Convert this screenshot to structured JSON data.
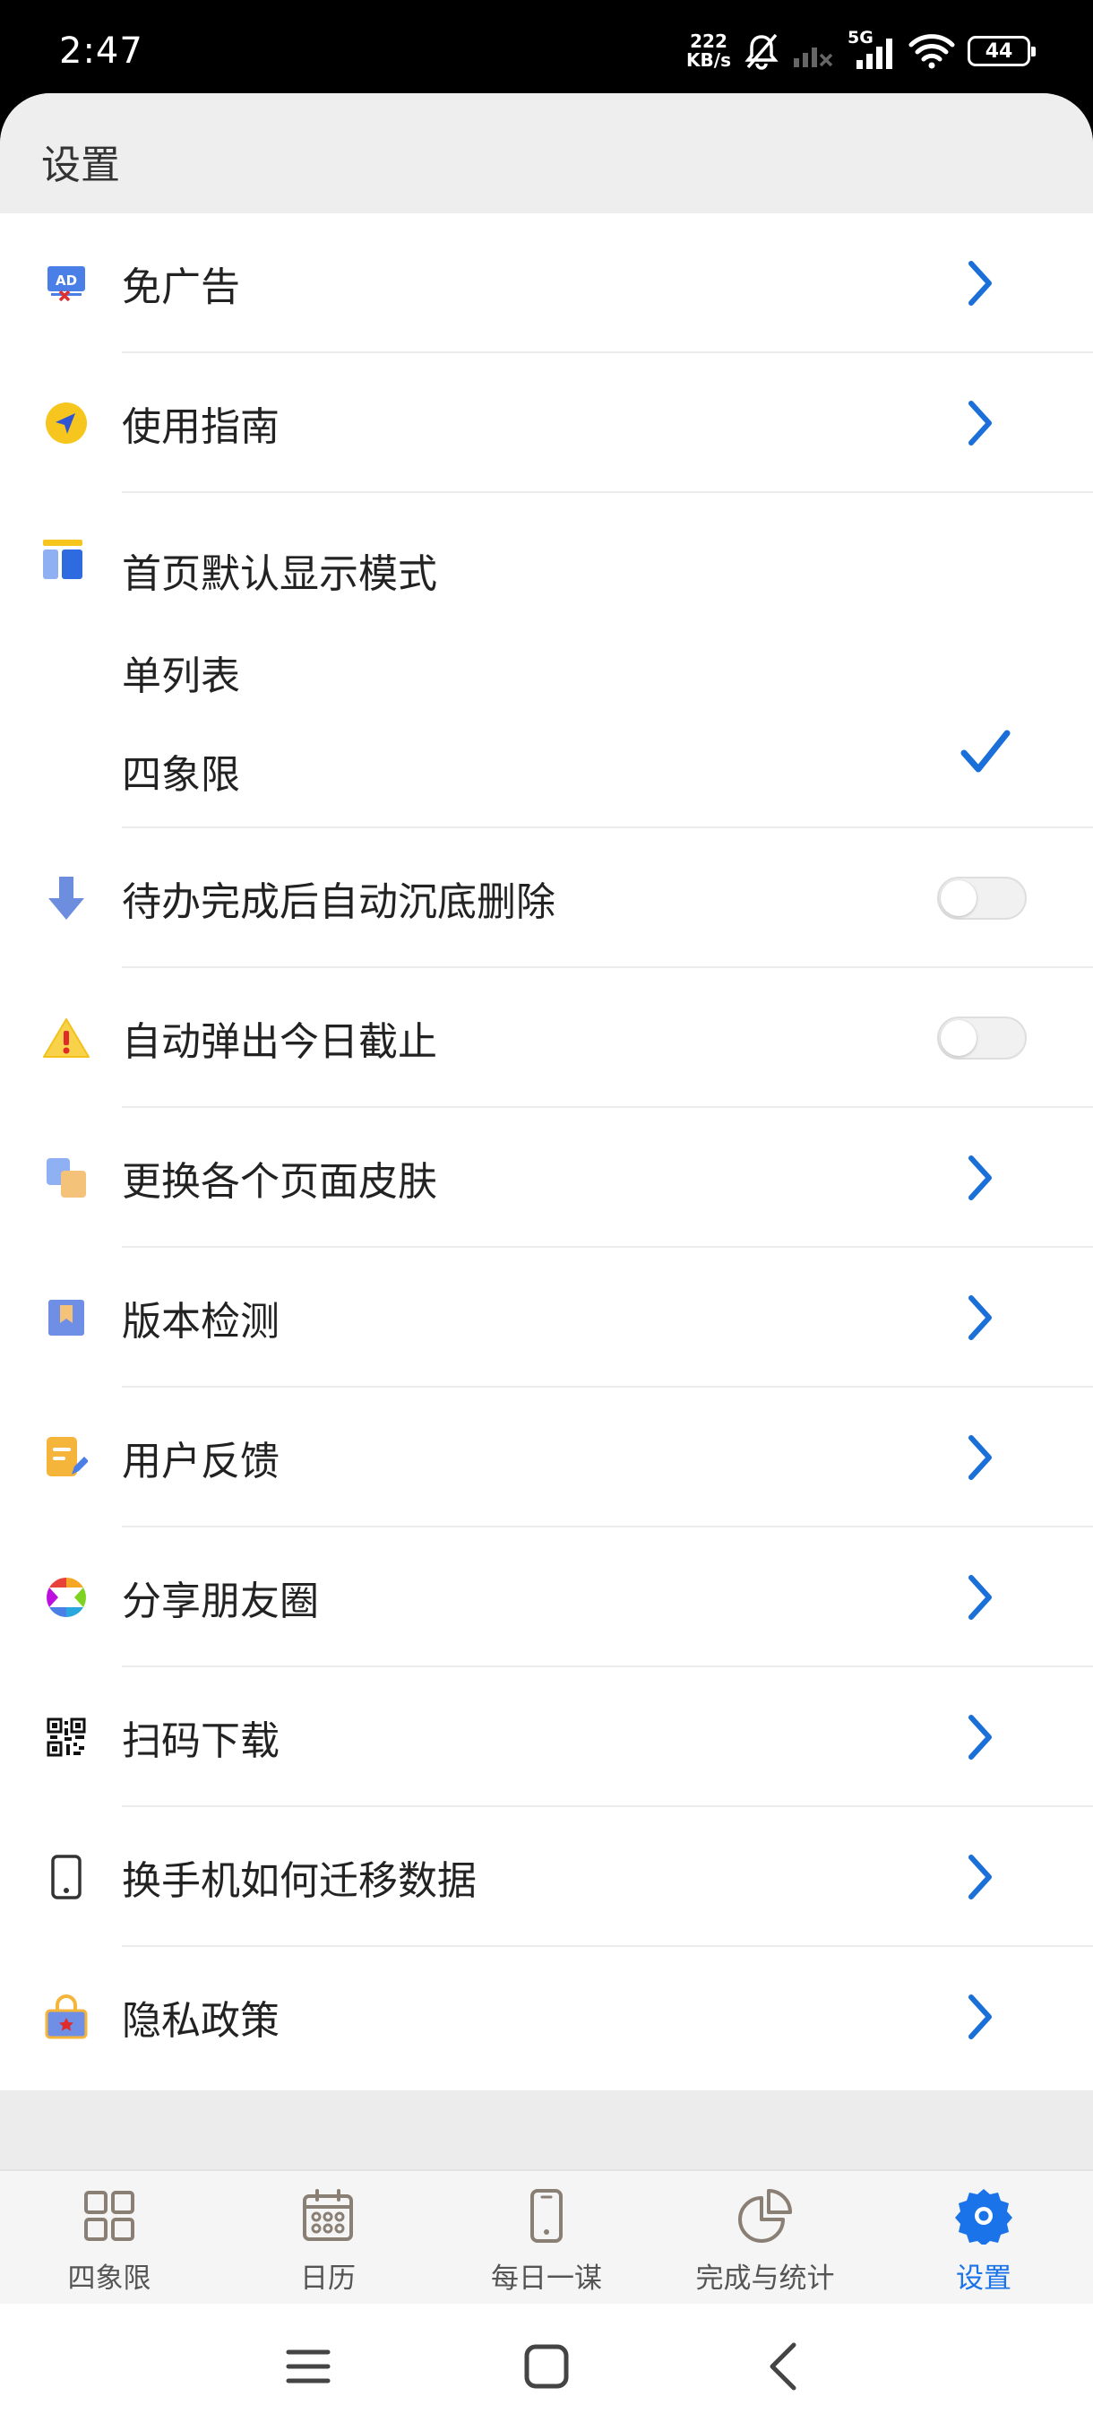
{
  "status_bar": {
    "time": "2:47",
    "net_speed_value": "222",
    "net_speed_unit": "KB/s",
    "network_type": "5G",
    "battery": "44"
  },
  "header": {
    "title": "设置"
  },
  "settings": {
    "remove_ads": "免广告",
    "guide": "使用指南",
    "home_mode_title": "首页默认显示模式",
    "mode_single_list": "单列表",
    "mode_quadrant": "四象限",
    "selected_mode": "四象限",
    "auto_sink_delete": "待办完成后自动沉底删除",
    "auto_sink_delete_on": false,
    "auto_popup_today": "自动弹出今日截止",
    "auto_popup_today_on": false,
    "change_skin": "更换各个页面皮肤",
    "version_check": "版本检测",
    "feedback": "用户反馈",
    "share_moments": "分享朋友圈",
    "scan_download": "扫码下载",
    "migrate_data": "换手机如何迁移数据",
    "privacy_policy": "隐私政策"
  },
  "tab_bar": {
    "tabs": [
      {
        "label": "四象限",
        "icon": "grid-icon",
        "active": false
      },
      {
        "label": "日历",
        "icon": "calendar-icon",
        "active": false
      },
      {
        "label": "每日一谋",
        "icon": "phone-icon",
        "active": false
      },
      {
        "label": "完成与统计",
        "icon": "pie-chart-icon",
        "active": false
      },
      {
        "label": "设置",
        "icon": "gear-icon",
        "active": true
      }
    ]
  },
  "colors": {
    "accent": "#1a73e8",
    "chevron": "#1a6fd8",
    "background": "#ececec",
    "icon_gray": "#8a7f75"
  }
}
